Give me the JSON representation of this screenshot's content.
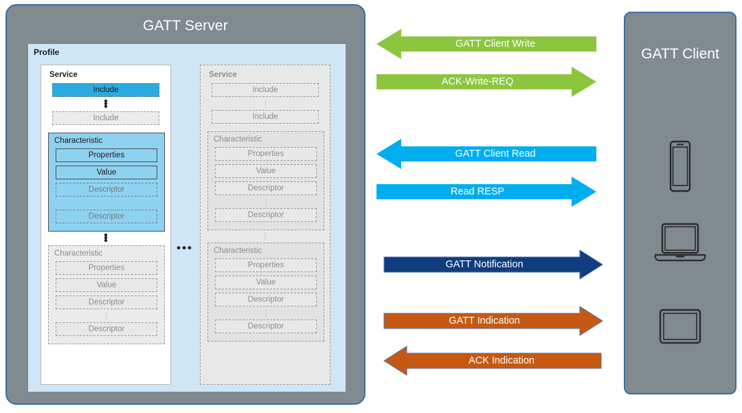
{
  "server": {
    "title": "GATT Server",
    "profile_label": "Profile",
    "column_ellipsis": "•••",
    "services": [
      {
        "label": "Service",
        "state": "active",
        "includes": [
          {
            "label": "Include",
            "style": "solid-blue"
          },
          {
            "label": "Include",
            "style": "ghost-white"
          }
        ],
        "characteristics": [
          {
            "label": "Characteristic",
            "style": "active",
            "rows": [
              {
                "label": "Properties",
                "style": "lt-blue"
              },
              {
                "label": "Value",
                "style": "lt-blue"
              },
              {
                "label": "Descriptor",
                "style": "ghost-on-blue"
              },
              {
                "label": "Descriptor",
                "style": "ghost-on-blue"
              }
            ]
          },
          {
            "label": "Characteristic",
            "style": "dim",
            "rows": [
              {
                "label": "Properties",
                "style": "ghost"
              },
              {
                "label": "Value",
                "style": "ghost"
              },
              {
                "label": "Descriptor",
                "style": "ghost"
              },
              {
                "label": "Descriptor",
                "style": "ghost"
              }
            ]
          }
        ]
      },
      {
        "label": "Service",
        "state": "ghost",
        "includes": [
          {
            "label": "Include",
            "style": "ghost"
          },
          {
            "label": "Include",
            "style": "ghost"
          }
        ],
        "characteristics": [
          {
            "label": "Characteristic",
            "style": "ghost",
            "rows": [
              {
                "label": "Properties",
                "style": "ghost"
              },
              {
                "label": "Value",
                "style": "ghost"
              },
              {
                "label": "Descriptor",
                "style": "ghost"
              },
              {
                "label": "Descriptor",
                "style": "ghost"
              }
            ]
          },
          {
            "label": "Characteristic",
            "style": "ghost",
            "rows": [
              {
                "label": "Properties",
                "style": "ghost"
              },
              {
                "label": "Value",
                "style": "ghost"
              },
              {
                "label": "Descriptor",
                "style": "ghost"
              },
              {
                "label": "Descriptor",
                "style": "ghost"
              }
            ]
          }
        ]
      }
    ]
  },
  "messages": [
    {
      "label": "GATT Client Write",
      "direction": "left",
      "color": "#8CC63F",
      "stroke": "#7ab32f"
    },
    {
      "label": "ACK-Write-REQ",
      "direction": "right",
      "color": "#8CC63F",
      "stroke": "#7ab32f"
    },
    {
      "label": "GATT Client Read",
      "direction": "left",
      "color": "#00AEEF",
      "stroke": "#00a0dc"
    },
    {
      "label": "Read RESP",
      "direction": "right",
      "color": "#00AEEF",
      "stroke": "#00a0dc"
    },
    {
      "label": "GATT Notification",
      "direction": "right",
      "color": "#103D80",
      "stroke": "#4a6fa5"
    },
    {
      "label": "GATT Indication",
      "direction": "right",
      "color": "#C65911",
      "stroke": "#4a6fa5"
    },
    {
      "label": "ACK Indication",
      "direction": "left",
      "color": "#C65911",
      "stroke": "#4a6fa5"
    }
  ],
  "client": {
    "title": "GATT Client",
    "devices": [
      "smartphone-icon",
      "laptop-icon",
      "tablet-icon"
    ]
  },
  "colors": {
    "panel_gray": "#808A8F",
    "panel_border_blue": "#3B6EA5",
    "profile_blue": "#CFE6F7",
    "accent_blue": "#29ABE2",
    "characteristic_blue": "#8ED2F2",
    "green": "#8CC63F",
    "cyan": "#00AEEF",
    "navy": "#103D80",
    "orange": "#C65911"
  }
}
